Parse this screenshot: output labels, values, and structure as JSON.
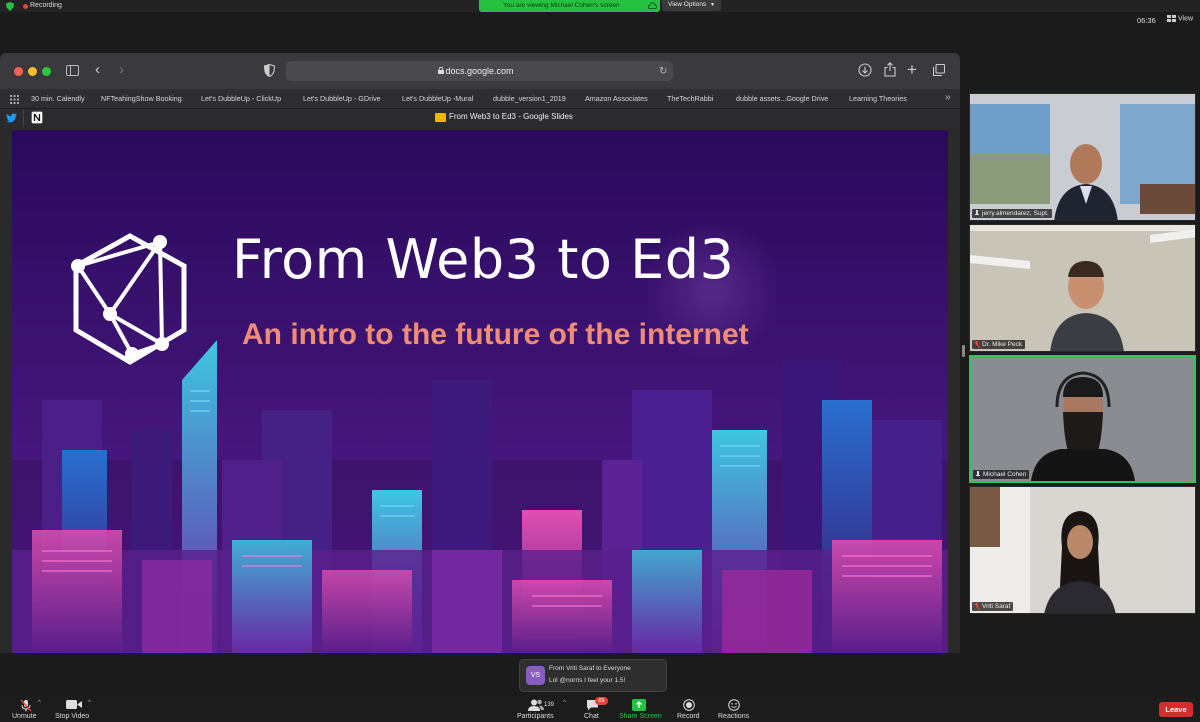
{
  "zoom": {
    "recording_label": "Recording",
    "viewing_banner": "You are viewing Michael Cohen's screen",
    "view_options_label": "View Options",
    "clock": "06:36",
    "view_label": "View"
  },
  "browser": {
    "url": "docs.google.com",
    "tab_title": "From Web3 to Ed3 - Google Slides",
    "bookmarks": [
      "30 min. Calendly",
      "NFTeahingShow Booking",
      "Let's DubbleUp - ClickUp",
      "Let's DubbleUp - GDrive",
      "Let's DubbleUp -Mural",
      "dubble_version1_2019",
      "Amazon Associates",
      "TheTechRabbi",
      "dubble assets...Google Drive",
      "Learning Theories"
    ]
  },
  "slide": {
    "title": "From Web3 to Ed3",
    "subtitle": "An intro to the future of the internet"
  },
  "participants": [
    {
      "name": "jerry.almendarez, Supt.",
      "muted": false,
      "active": false
    },
    {
      "name": "Dr. Mike Peck",
      "muted": true,
      "active": false
    },
    {
      "name": "Michael Cohen",
      "muted": false,
      "active": true
    },
    {
      "name": "Vriti Saraf",
      "muted": true,
      "active": false
    }
  ],
  "chat_notification": {
    "avatar_initials": "VS",
    "from": "From Vriti Saraf to Everyone",
    "message": "Lol @norris I feel your 1.5!"
  },
  "toolbar": {
    "unmute": "Unmute",
    "stop_video": "Stop Video",
    "participants": "Participants",
    "participant_count": "139",
    "chat": "Chat",
    "chat_badge": "66",
    "share_screen": "Share Screen",
    "record": "Record",
    "reactions": "Reactions",
    "leave": "Leave"
  },
  "colors": {
    "zoom_green": "#27c142",
    "leave_red": "#d42d2d",
    "slide_subtitle": "#ee8c78",
    "active_speaker_border": "#31c45a"
  }
}
